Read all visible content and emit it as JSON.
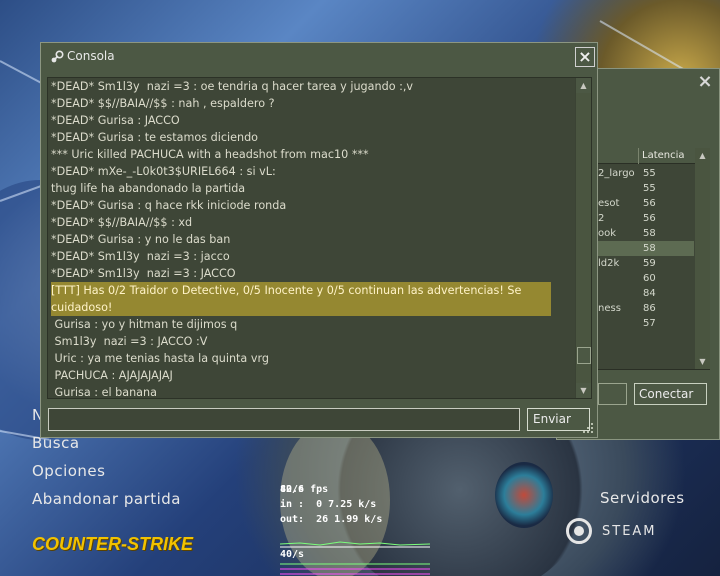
{
  "console": {
    "title": "Consola",
    "send_label": "Enviar",
    "input_value": "",
    "close_glyph": "×",
    "lines": [
      {
        "text": "*DEAD* Sm1l3y  nazi =3 : oe tendria q hacer tarea y jugando :,v",
        "highlight": false
      },
      {
        "text": "*DEAD* $$//BAIA//$$ : nah , espaldero ?",
        "highlight": false
      },
      {
        "text": "*DEAD* Gurisa : JACCO",
        "highlight": false
      },
      {
        "text": "*DEAD* Gurisa : te estamos diciendo",
        "highlight": false
      },
      {
        "text": "*** Uric killed PACHUCA with a headshot from mac10 ***",
        "highlight": false
      },
      {
        "text": "*DEAD* mXe-_-L0k0t3$URIEL664 : si vL:",
        "highlight": false
      },
      {
        "text": "thug life ha abandonado la partida",
        "highlight": false
      },
      {
        "text": "*DEAD* Gurisa : q hace rkk iniciode ronda",
        "highlight": false
      },
      {
        "text": "*DEAD* $$//BAIA//$$ : xd",
        "highlight": false
      },
      {
        "text": "*DEAD* Gurisa : y no le das ban",
        "highlight": false
      },
      {
        "text": "*DEAD* Sm1l3y  nazi =3 : jacco",
        "highlight": false
      },
      {
        "text": "*DEAD* Sm1l3y  nazi =3 : JACCO",
        "highlight": false
      },
      {
        "text": "[TTT] Has 0/2 Traidor o Detective, 0/5 Inocente y 0/5 continuan las advertencias! Se cuidadoso!",
        "highlight": true
      },
      {
        "text": " Gurisa : yo y hitman te dijimos q",
        "highlight": false
      },
      {
        "text": " Sm1l3y  nazi =3 : JACCO :V",
        "highlight": false
      },
      {
        "text": " Uric : ya me tenias hasta la quinta vrg",
        "highlight": false
      },
      {
        "text": " PACHUCA : AJAJAJAJAJ",
        "highlight": false
      },
      {
        "text": " Gurisa : el banana",
        "highlight": false
      }
    ]
  },
  "server_browser": {
    "close_glyph": "×",
    "column_latency": "Latencia",
    "connect_label": "Conectar",
    "rows": [
      {
        "name": "2_largo",
        "latency": "55",
        "selected": false
      },
      {
        "name": "",
        "latency": "55",
        "selected": false
      },
      {
        "name": "esot",
        "latency": "56",
        "selected": false
      },
      {
        "name": "2",
        "latency": "56",
        "selected": false
      },
      {
        "name": "ook",
        "latency": "58",
        "selected": false
      },
      {
        "name": "",
        "latency": "58",
        "selected": true
      },
      {
        "name": "ld2k",
        "latency": "59",
        "selected": false
      },
      {
        "name": "",
        "latency": "60",
        "selected": false
      },
      {
        "name": "",
        "latency": "84",
        "selected": false
      },
      {
        "name": "ness",
        "latency": "86",
        "selected": false
      },
      {
        "name": "",
        "latency": "57",
        "selected": false
      }
    ]
  },
  "main_menu": {
    "partial_item": "N",
    "items": [
      "Busca",
      "Opciones",
      "Abandonar partida"
    ],
    "servers_label": "Servidores",
    "logo_text": "COUNTER-STRIKE",
    "steam_text": "STEAM"
  },
  "netgraph": {
    "fps": "82.6 fps",
    "fps_rate": "40/s",
    "in_line": "in :  0 7.25 k/s",
    "out_line": "out:  26 1.99 k/s",
    "rate2": "40/s"
  },
  "colors": {
    "panel": "#4c5844",
    "panel_dark": "#3e4637",
    "highlight_bg": "#958831",
    "logo_yellow": "#f2c200"
  }
}
